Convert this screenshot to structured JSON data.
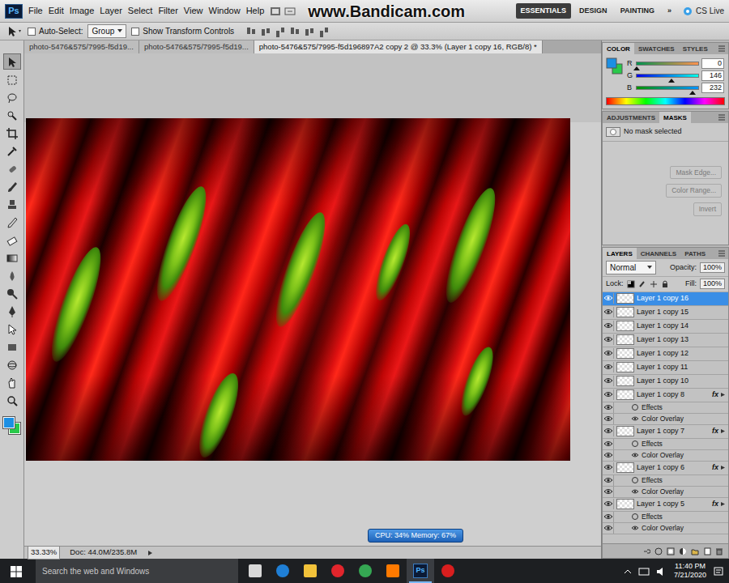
{
  "app": {
    "logo": "Ps",
    "watermark": "www.Bandicam.com"
  },
  "menu": [
    "File",
    "Edit",
    "Image",
    "Layer",
    "Select",
    "Filter",
    "View",
    "Window",
    "Help"
  ],
  "workspaces": [
    {
      "label": "ESSENTIALS",
      "selected": true
    },
    {
      "label": "DESIGN",
      "selected": false
    },
    {
      "label": "PAINTING",
      "selected": false
    }
  ],
  "workspace_more": "»",
  "cs_live": "CS Live",
  "options": {
    "auto_select": {
      "label": "Auto-Select:",
      "checked": false
    },
    "auto_select_target": "Group",
    "transform_controls": {
      "label": "Show Transform Controls",
      "checked": false
    }
  },
  "documents": [
    {
      "label": "photo-5476&575/7995-f5d19...",
      "selected": false
    },
    {
      "label": "photo-5476&575/7995-f5d19...",
      "selected": false
    },
    {
      "label": "photo-5476&575/7995-f5d196897A2 copy 2 @ 33.3% (Layer 1 copy 16, RGB/8) *",
      "selected": true
    }
  ],
  "tools": [
    {
      "selected": true
    },
    {
      "selected": false
    },
    {
      "selected": false
    },
    {
      "selected": false
    },
    {
      "selected": false
    },
    {
      "selected": false
    },
    {
      "selected": false
    },
    {
      "selected": false
    },
    {
      "selected": false
    },
    {
      "selected": false
    },
    {
      "selected": false
    },
    {
      "selected": false
    },
    {
      "selected": false
    },
    {
      "selected": false
    },
    {
      "selected": false
    },
    {
      "selected": false
    },
    {
      "selected": false
    },
    {
      "selected": false
    },
    {
      "selected": false
    },
    {
      "selected": false
    }
  ],
  "swatches": {
    "foreground": {
      "color": "#1c8fe3"
    },
    "background": {
      "color": "#29c94a"
    }
  },
  "color_panel": {
    "tabs": [
      {
        "label": "COLOR",
        "selected": true
      },
      {
        "label": "SWATCHES",
        "selected": false
      },
      {
        "label": "STYLES",
        "selected": false
      }
    ],
    "channels": [
      {
        "label": "R",
        "value": "0",
        "level": 0
      },
      {
        "label": "G",
        "value": "146",
        "level": 0.57
      },
      {
        "label": "B",
        "value": "232",
        "level": 0.91
      }
    ]
  },
  "masks_panel": {
    "tabs": [
      {
        "label": "ADJUSTMENTS",
        "selected": false
      },
      {
        "label": "MASKS",
        "selected": true
      }
    ],
    "message": "No mask selected",
    "actions": [
      {
        "label": "Mask Edge...",
        "disabled": true
      },
      {
        "label": "Color Range...",
        "disabled": true
      },
      {
        "label": "Invert",
        "disabled": true
      }
    ]
  },
  "layers_panel": {
    "tabs": [
      {
        "label": "LAYERS",
        "selected": true
      },
      {
        "label": "CHANNELS",
        "selected": false
      },
      {
        "label": "PATHS",
        "selected": false
      }
    ],
    "blend_mode": "Normal",
    "opacity_label": "Opacity:",
    "opacity": "100%",
    "lock_label": "Lock:",
    "fill_label": "Fill:",
    "fill": "100%",
    "fx_label": "fx",
    "rows": [
      {
        "kind": "layer",
        "name": "Layer 1 copy 16",
        "selected": true,
        "visible": true,
        "fx": false
      },
      {
        "kind": "layer",
        "name": "Layer 1 copy 15",
        "selected": false,
        "visible": true,
        "fx": false
      },
      {
        "kind": "layer",
        "name": "Layer 1 copy 14",
        "selected": false,
        "visible": true,
        "fx": false
      },
      {
        "kind": "layer",
        "name": "Layer 1 copy 13",
        "selected": false,
        "visible": true,
        "fx": false
      },
      {
        "kind": "layer",
        "name": "Layer 1 copy 12",
        "selected": false,
        "visible": true,
        "fx": false
      },
      {
        "kind": "layer",
        "name": "Layer 1 copy 11",
        "selected": false,
        "visible": true,
        "fx": false
      },
      {
        "kind": "layer",
        "name": "Layer 1 copy 10",
        "selected": false,
        "visible": true,
        "fx": false
      },
      {
        "kind": "layer",
        "name": "Layer 1 copy 8",
        "selected": false,
        "visible": true,
        "fx": true
      },
      {
        "kind": "effects",
        "name": "Effects",
        "selected": false,
        "visible": true,
        "fx": false
      },
      {
        "kind": "effect",
        "name": "Color Overlay",
        "selected": false,
        "visible": true,
        "fx": false
      },
      {
        "kind": "layer",
        "name": "Layer 1 copy 7",
        "selected": false,
        "visible": true,
        "fx": true
      },
      {
        "kind": "effects",
        "name": "Effects",
        "selected": false,
        "visible": true,
        "fx": false
      },
      {
        "kind": "effect",
        "name": "Color Overlay",
        "selected": false,
        "visible": true,
        "fx": false
      },
      {
        "kind": "layer",
        "name": "Layer 1 copy 6",
        "selected": false,
        "visible": true,
        "fx": true
      },
      {
        "kind": "effects",
        "name": "Effects",
        "selected": false,
        "visible": true,
        "fx": false
      },
      {
        "kind": "effect",
        "name": "Color Overlay",
        "selected": false,
        "visible": true,
        "fx": false
      },
      {
        "kind": "layer",
        "name": "Layer 1 copy 5",
        "selected": false,
        "visible": true,
        "fx": true
      },
      {
        "kind": "effects",
        "name": "Effects",
        "selected": false,
        "visible": true,
        "fx": false
      },
      {
        "kind": "effect",
        "name": "Color Overlay",
        "selected": false,
        "visible": true,
        "fx": false
      }
    ]
  },
  "status": {
    "zoom": "33.33%",
    "doc": "Doc: 44.0M/235.8M"
  },
  "perf": "CPU: 34% Memory: 67%",
  "taskbar": {
    "search": "Search the web and Windows",
    "apps": [
      {
        "kind": "tile",
        "color": "#d8d8d8",
        "selected": false
      },
      {
        "kind": "circle",
        "color": "#1f7fd6",
        "selected": false
      },
      {
        "kind": "tile",
        "color": "#f2c23a",
        "selected": false
      },
      {
        "kind": "circle",
        "color": "#e2252c",
        "selected": false
      },
      {
        "kind": "circle",
        "color": "#35a853",
        "selected": false
      },
      {
        "kind": "tile",
        "color": "#ff7a00",
        "selected": false
      },
      {
        "kind": "ps",
        "color": "#4fb6ff",
        "selected": true,
        "label": "Ps"
      },
      {
        "kind": "circle",
        "color": "#d91e1e",
        "selected": false
      }
    ],
    "time": "11:40 PM",
    "date": "7/21/2020"
  }
}
